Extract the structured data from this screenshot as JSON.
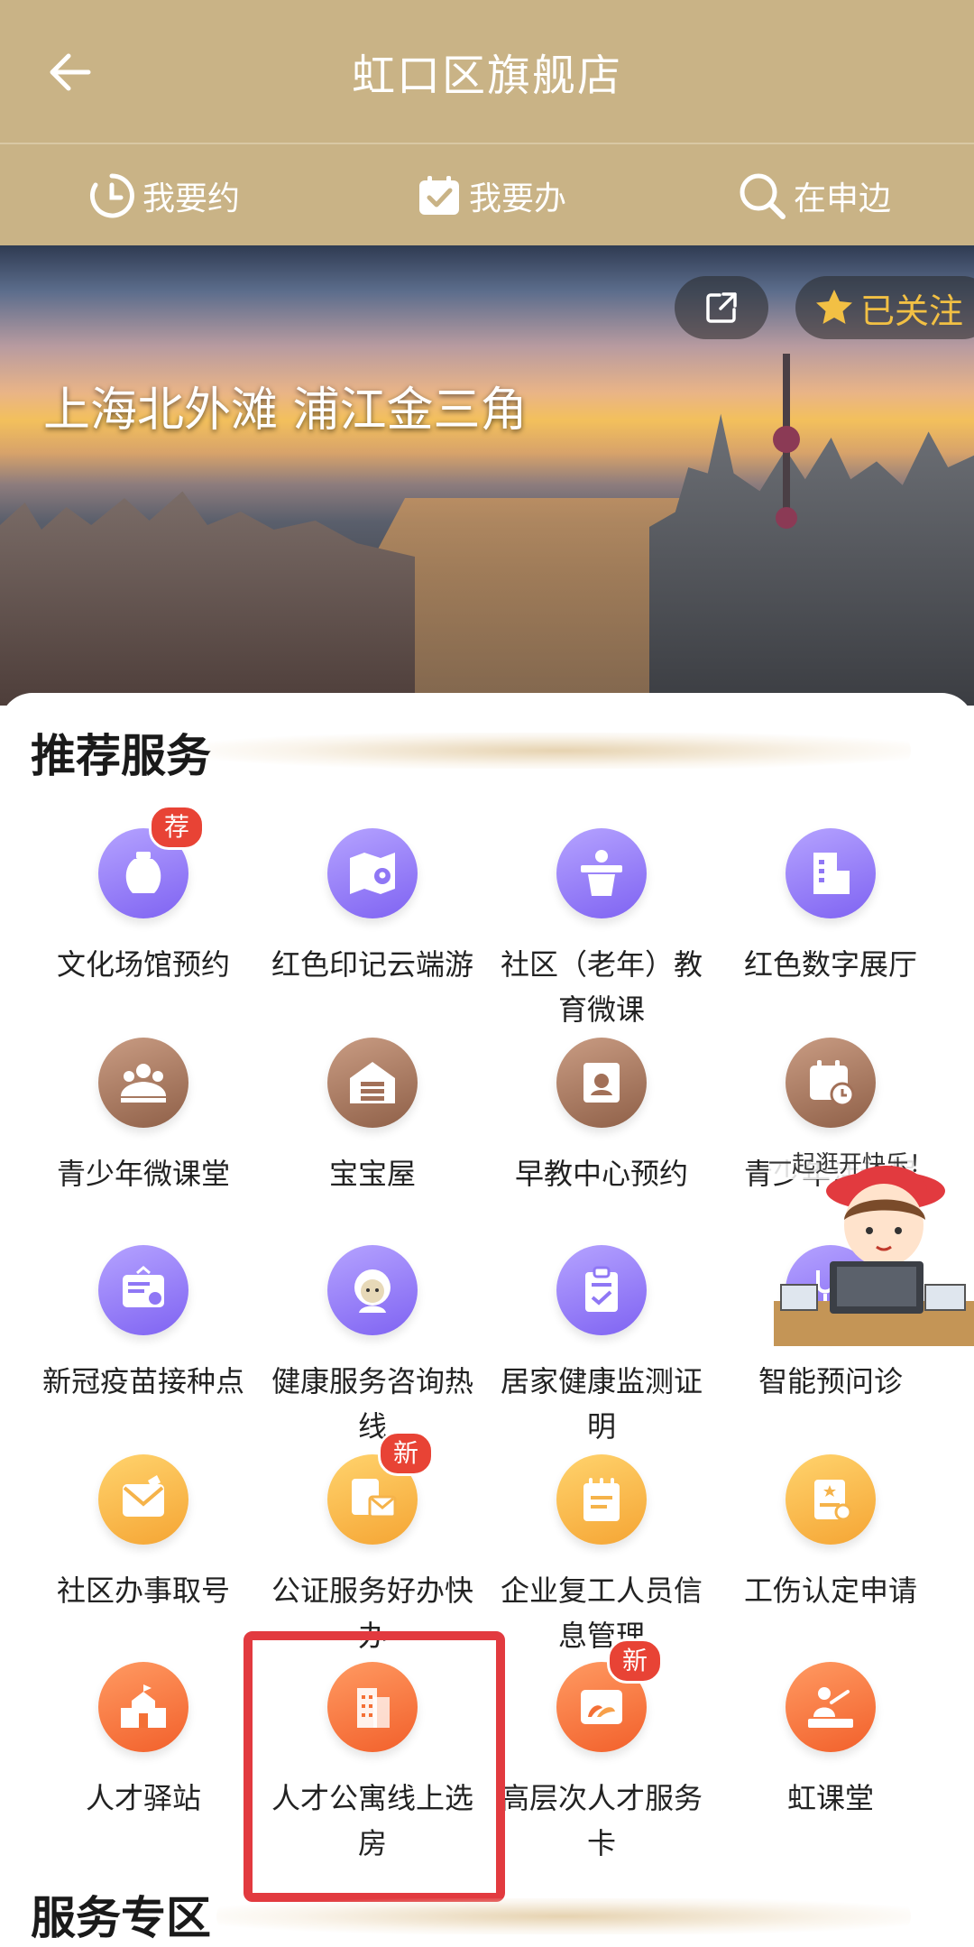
{
  "header": {
    "title": "虹口区旗舰店"
  },
  "tabs": [
    {
      "label": "我要约",
      "icon": "clock-icon"
    },
    {
      "label": "我要办",
      "icon": "checkbox-icon"
    },
    {
      "label": "在申边",
      "icon": "search-icon"
    }
  ],
  "banner": {
    "caption": "上海北外滩  浦江金三角",
    "follow_label": "已关注",
    "share_icon": "share-icon",
    "star_icon": "star-icon"
  },
  "recommended": {
    "title": "推荐服务",
    "items": [
      {
        "label": "文化场馆预约",
        "icon": "vase-icon",
        "badge": "荐"
      },
      {
        "label": "红色印记云端游",
        "icon": "map-icon"
      },
      {
        "label": "社区（老年）教育微课",
        "icon": "podium-icon"
      },
      {
        "label": "红色数字展厅",
        "icon": "building-icon"
      },
      {
        "label": "青少年微课堂",
        "icon": "classroom-icon"
      },
      {
        "label": "宝宝屋",
        "icon": "house-icon"
      },
      {
        "label": "早教中心预约",
        "icon": "baby-icon"
      },
      {
        "label": "青少年活动报",
        "icon": "calendar-icon"
      },
      {
        "label": "新冠疫苗接种点",
        "icon": "card-icon"
      },
      {
        "label": "健康服务咨询热线",
        "icon": "elder-icon"
      },
      {
        "label": "居家健康监测证明",
        "icon": "clipboard-icon"
      },
      {
        "label": "智能预问诊",
        "icon": "stethoscope-icon"
      },
      {
        "label": "社区办事取号",
        "icon": "envelope-icon"
      },
      {
        "label": "公证服务好办快办",
        "icon": "notary-icon",
        "badge": "新"
      },
      {
        "label": "企业复工人员信息管理",
        "icon": "notebook-icon"
      },
      {
        "label": "工伤认定申请",
        "icon": "certificate-icon"
      },
      {
        "label": "人才驿站",
        "icon": "school-icon"
      },
      {
        "label": "人才公寓线上选房",
        "icon": "apartment-icon"
      },
      {
        "label": "高层次人才服务卡",
        "icon": "photo-card-icon",
        "badge": "新"
      },
      {
        "label": "虹课堂",
        "icon": "teacher-icon"
      }
    ]
  },
  "mascot": {
    "bubble": "一起逛开快乐！"
  },
  "service_zone": {
    "title": "服务专区"
  }
}
